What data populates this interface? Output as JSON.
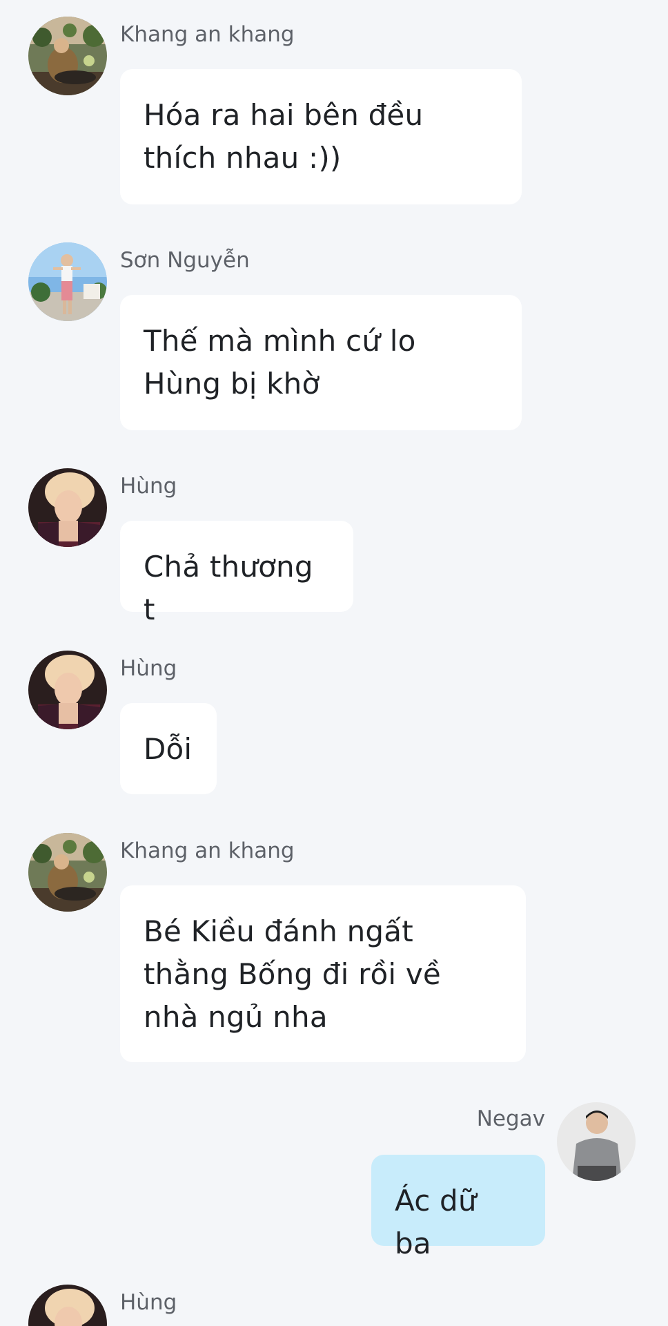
{
  "messages": [
    {
      "sender": "Khang an khang",
      "text": "Hóa ra hai bên đều thích nhau :))",
      "avatar": "khang-avatar"
    },
    {
      "sender": "Sơn Nguyễn",
      "text": "Thế mà mình cứ lo Hùng bị khờ",
      "avatar": "son-avatar"
    },
    {
      "sender": "Hùng",
      "text": "Chả thương t",
      "avatar": "hung-avatar"
    },
    {
      "sender": "Hùng",
      "text": "Dỗi",
      "avatar": "hung-avatar"
    },
    {
      "sender": "Khang an khang",
      "text": "Bé Kiều đánh ngất thằng Bống đi rồi về nhà ngủ nha",
      "avatar": "khang-avatar"
    },
    {
      "sender": "Negav",
      "text": "Ác dữ ba",
      "avatar": "negav-avatar",
      "mine": true
    },
    {
      "sender": "Hùng",
      "text": "",
      "avatar": "hung-avatar"
    }
  ],
  "colors": {
    "background": "#f4f6f9",
    "incoming_bubble": "#ffffff",
    "outgoing_bubble": "#c8ecfb",
    "sender_name": "#5d6168",
    "message_text": "#1f2226"
  }
}
